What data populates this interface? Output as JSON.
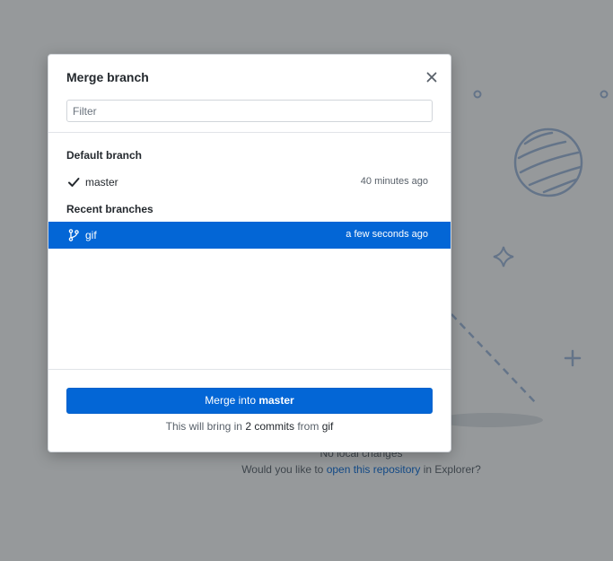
{
  "background": {
    "no_changes_text": "No local changes",
    "prompt_prefix": "Would you like to ",
    "prompt_link": "open this repository",
    "prompt_suffix": " in Explorer?"
  },
  "dialog": {
    "title": "Merge branch",
    "close_icon": "close-icon",
    "filter_placeholder": "Filter",
    "filter_value": "",
    "groups": [
      {
        "header": "Default branch",
        "items": [
          {
            "name": "master",
            "time": "40 minutes ago",
            "icon": "check-icon",
            "selected": false
          }
        ]
      },
      {
        "header": "Recent branches",
        "items": [
          {
            "name": "gif",
            "time": "a few seconds ago",
            "icon": "git-branch-icon",
            "selected": true
          }
        ]
      }
    ],
    "merge_button": {
      "prefix": "Merge into ",
      "branch": "master"
    },
    "note": {
      "prefix": "This will bring in ",
      "count": "2 commits",
      "middle": " from ",
      "branch": "gif"
    }
  },
  "colors": {
    "accent": "#0366d6",
    "overlay": "#24292e",
    "illustration": "#b0c8e6"
  }
}
